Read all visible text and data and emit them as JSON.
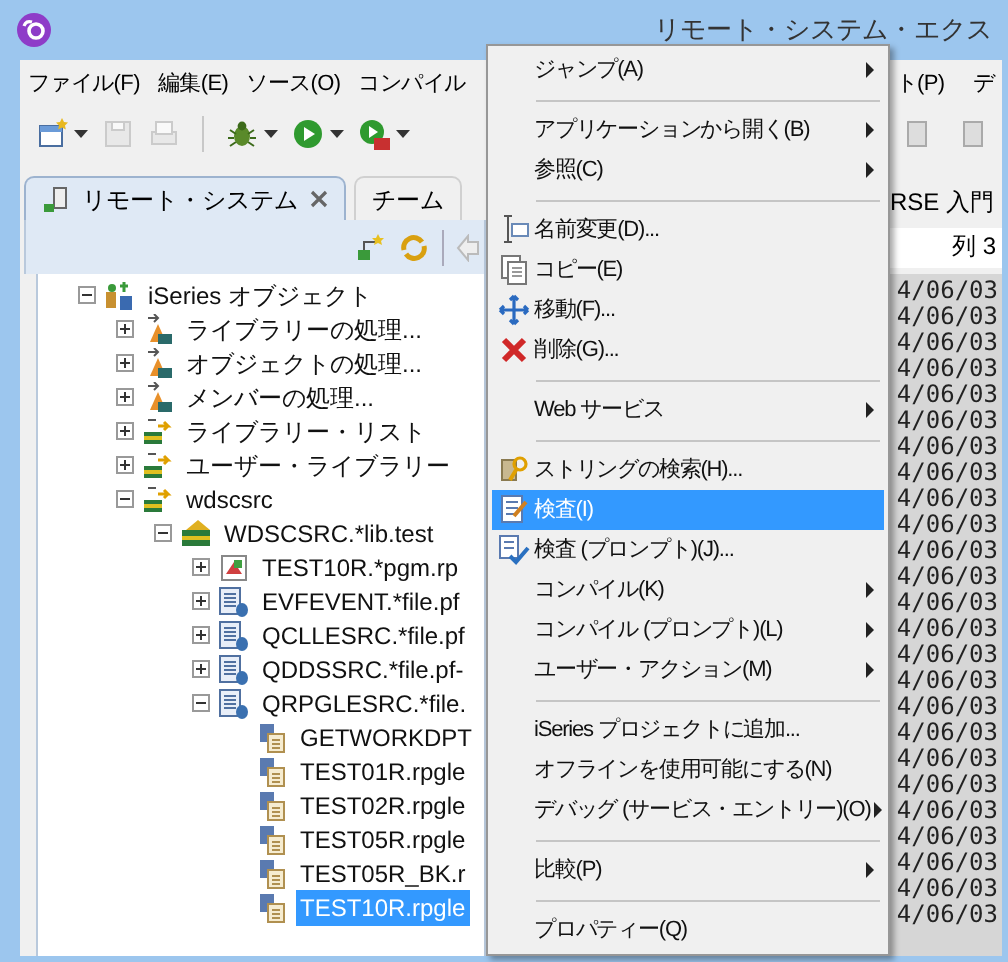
{
  "window": {
    "title": "リモート・システム・エクス"
  },
  "menu_bar": {
    "left": [
      "ファイル(F)",
      "編集(E)",
      "ソース(O)",
      "コンパイル"
    ],
    "right": [
      "ト(P)",
      "デ"
    ]
  },
  "toolbar": [
    {
      "kind": "new",
      "disabled": false,
      "dropdown": true
    },
    {
      "kind": "save",
      "disabled": true,
      "dropdown": false
    },
    {
      "kind": "print",
      "disabled": true,
      "dropdown": false
    },
    {
      "kind": "separator"
    },
    {
      "kind": "debug",
      "disabled": false,
      "dropdown": true
    },
    {
      "kind": "run",
      "disabled": false,
      "dropdown": true
    },
    {
      "kind": "run-stop",
      "disabled": false,
      "dropdown": true
    }
  ],
  "tabs": [
    {
      "label": "リモート・システム",
      "selected": true,
      "closable": true
    },
    {
      "label": "チーム",
      "selected": false,
      "closable": false
    }
  ],
  "tree": [
    {
      "label": "iSeries オブジェクト",
      "kind": "subsystem",
      "expanded": true,
      "selected": false,
      "children": [
        {
          "label": "ライブラリーの処理...",
          "kind": "filter",
          "expanded": false,
          "selected": false
        },
        {
          "label": "オブジェクトの処理...",
          "kind": "filter",
          "expanded": false,
          "selected": false
        },
        {
          "label": "メンバーの処理...",
          "kind": "filter",
          "expanded": false,
          "selected": false
        },
        {
          "label": "ライブラリー・リスト",
          "kind": "pool",
          "expanded": false,
          "selected": false
        },
        {
          "label": "ユーザー・ライブラリー",
          "kind": "pool",
          "expanded": false,
          "selected": false
        },
        {
          "label": "wdscsrc",
          "kind": "pool",
          "expanded": true,
          "selected": false,
          "children": [
            {
              "label": "WDSCSRC.*lib.test",
              "kind": "library",
              "expanded": true,
              "selected": false,
              "children": [
                {
                  "label": "TEST10R.*pgm.rp",
                  "kind": "program",
                  "expanded": false,
                  "selected": false
                },
                {
                  "label": "EVFEVENT.*file.pf",
                  "kind": "file",
                  "expanded": false,
                  "selected": false
                },
                {
                  "label": "QCLLESRC.*file.pf",
                  "kind": "file",
                  "expanded": false,
                  "selected": false
                },
                {
                  "label": "QDDSSRC.*file.pf-",
                  "kind": "file",
                  "expanded": false,
                  "selected": false
                },
                {
                  "label": "QRPGLESRC.*file.",
                  "kind": "file",
                  "expanded": true,
                  "selected": false,
                  "children": [
                    {
                      "label": "GETWORKDPT",
                      "kind": "member",
                      "selected": false
                    },
                    {
                      "label": "TEST01R.rpgle",
                      "kind": "member",
                      "selected": false
                    },
                    {
                      "label": "TEST02R.rpgle",
                      "kind": "member",
                      "selected": false
                    },
                    {
                      "label": "TEST05R.rpgle",
                      "kind": "member",
                      "selected": false
                    },
                    {
                      "label": "TEST05R_BK.r",
                      "kind": "member",
                      "selected": false
                    },
                    {
                      "label": "TEST10R.rpgle",
                      "kind": "member",
                      "selected": true
                    }
                  ]
                }
              ]
            }
          ]
        }
      ]
    }
  ],
  "right_panel": {
    "tab": "RSE 入門",
    "field": "列 3",
    "dates": [
      "4/06/03",
      "4/06/03",
      "4/06/03",
      "4/06/03",
      "4/06/03",
      "4/06/03",
      "4/06/03",
      "4/06/03",
      "4/06/03",
      "4/06/03",
      "4/06/03",
      "4/06/03",
      "4/06/03",
      "4/06/03",
      "4/06/03",
      "4/06/03",
      "4/06/03",
      "4/06/03",
      "4/06/03",
      "4/06/03",
      "4/06/03",
      "4/06/03",
      "4/06/03",
      "4/06/03",
      "4/06/03"
    ]
  },
  "context_menu": [
    {
      "kind": "item",
      "label": "ジャンプ(A)",
      "submenu": true,
      "selected": false
    },
    {
      "kind": "separator"
    },
    {
      "kind": "item",
      "label": "アプリケーションから開く(B)",
      "submenu": true,
      "selected": false
    },
    {
      "kind": "item",
      "label": "参照(C)",
      "submenu": true,
      "selected": false
    },
    {
      "kind": "separator"
    },
    {
      "kind": "item",
      "label": "名前変更(D)...",
      "submenu": false,
      "selected": false
    },
    {
      "kind": "item",
      "label": "コピー(E)",
      "submenu": false,
      "selected": false
    },
    {
      "kind": "item",
      "label": "移動(F)...",
      "submenu": false,
      "selected": false
    },
    {
      "kind": "item",
      "label": "削除(G)...",
      "submenu": false,
      "selected": false
    },
    {
      "kind": "separator"
    },
    {
      "kind": "item",
      "label": "Web サービス",
      "submenu": true,
      "selected": false
    },
    {
      "kind": "separator"
    },
    {
      "kind": "item",
      "label": "ストリングの検索(H)...",
      "submenu": false,
      "selected": false
    },
    {
      "kind": "item",
      "label": "検査(I)",
      "submenu": false,
      "selected": true
    },
    {
      "kind": "item",
      "label": "検査 (プロンプト)(J)...",
      "submenu": false,
      "selected": false
    },
    {
      "kind": "item",
      "label": "コンパイル(K)",
      "submenu": true,
      "selected": false
    },
    {
      "kind": "item",
      "label": "コンパイル (プロンプト)(L)",
      "submenu": true,
      "selected": false
    },
    {
      "kind": "item",
      "label": "ユーザー・アクション(M)",
      "submenu": true,
      "selected": false
    },
    {
      "kind": "separator"
    },
    {
      "kind": "item",
      "label": "iSeries プロジェクトに追加...",
      "submenu": false,
      "selected": false
    },
    {
      "kind": "item",
      "label": "オフラインを使用可能にする(N)",
      "submenu": false,
      "selected": false
    },
    {
      "kind": "item",
      "label": "デバッグ (サービス・エントリー)(O)",
      "submenu": true,
      "selected": false
    },
    {
      "kind": "separator"
    },
    {
      "kind": "item",
      "label": "比較(P)",
      "submenu": true,
      "selected": false
    },
    {
      "kind": "separator"
    },
    {
      "kind": "item",
      "label": "プロパティー(Q)",
      "submenu": false,
      "selected": false
    }
  ]
}
